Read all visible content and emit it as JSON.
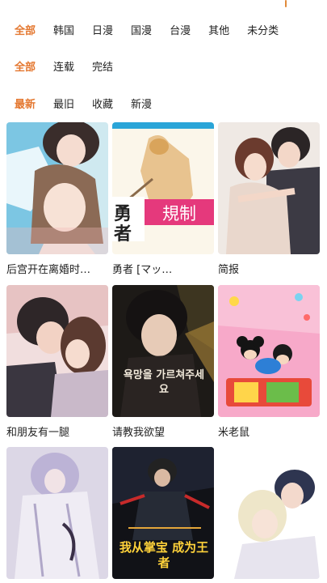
{
  "filters": {
    "region": [
      "全部",
      "韩国",
      "日漫",
      "国漫",
      "台漫",
      "其他",
      "未分类"
    ],
    "status": [
      "全部",
      "连载",
      "完结"
    ],
    "sort": [
      "最新",
      "最旧",
      "收藏",
      "新漫"
    ]
  },
  "comics": [
    {
      "title": "后宫开在离婚时…"
    },
    {
      "title": "勇者 [マッ…",
      "cover_text": [
        "勇",
        "者",
        "規制"
      ]
    },
    {
      "title": "简报"
    },
    {
      "title": "和朋友有一腿"
    },
    {
      "title": "请教我欲望",
      "cover_text": "욕망을 가르쳐주세요"
    },
    {
      "title": "米老鼠"
    },
    {
      "title": ""
    },
    {
      "title": "",
      "cover_text": "我从掌宝 成为王者"
    },
    {
      "title": ""
    }
  ],
  "colors": {
    "accent": "#e4772f",
    "text": "#222222",
    "divider": "#f2f2f2"
  }
}
